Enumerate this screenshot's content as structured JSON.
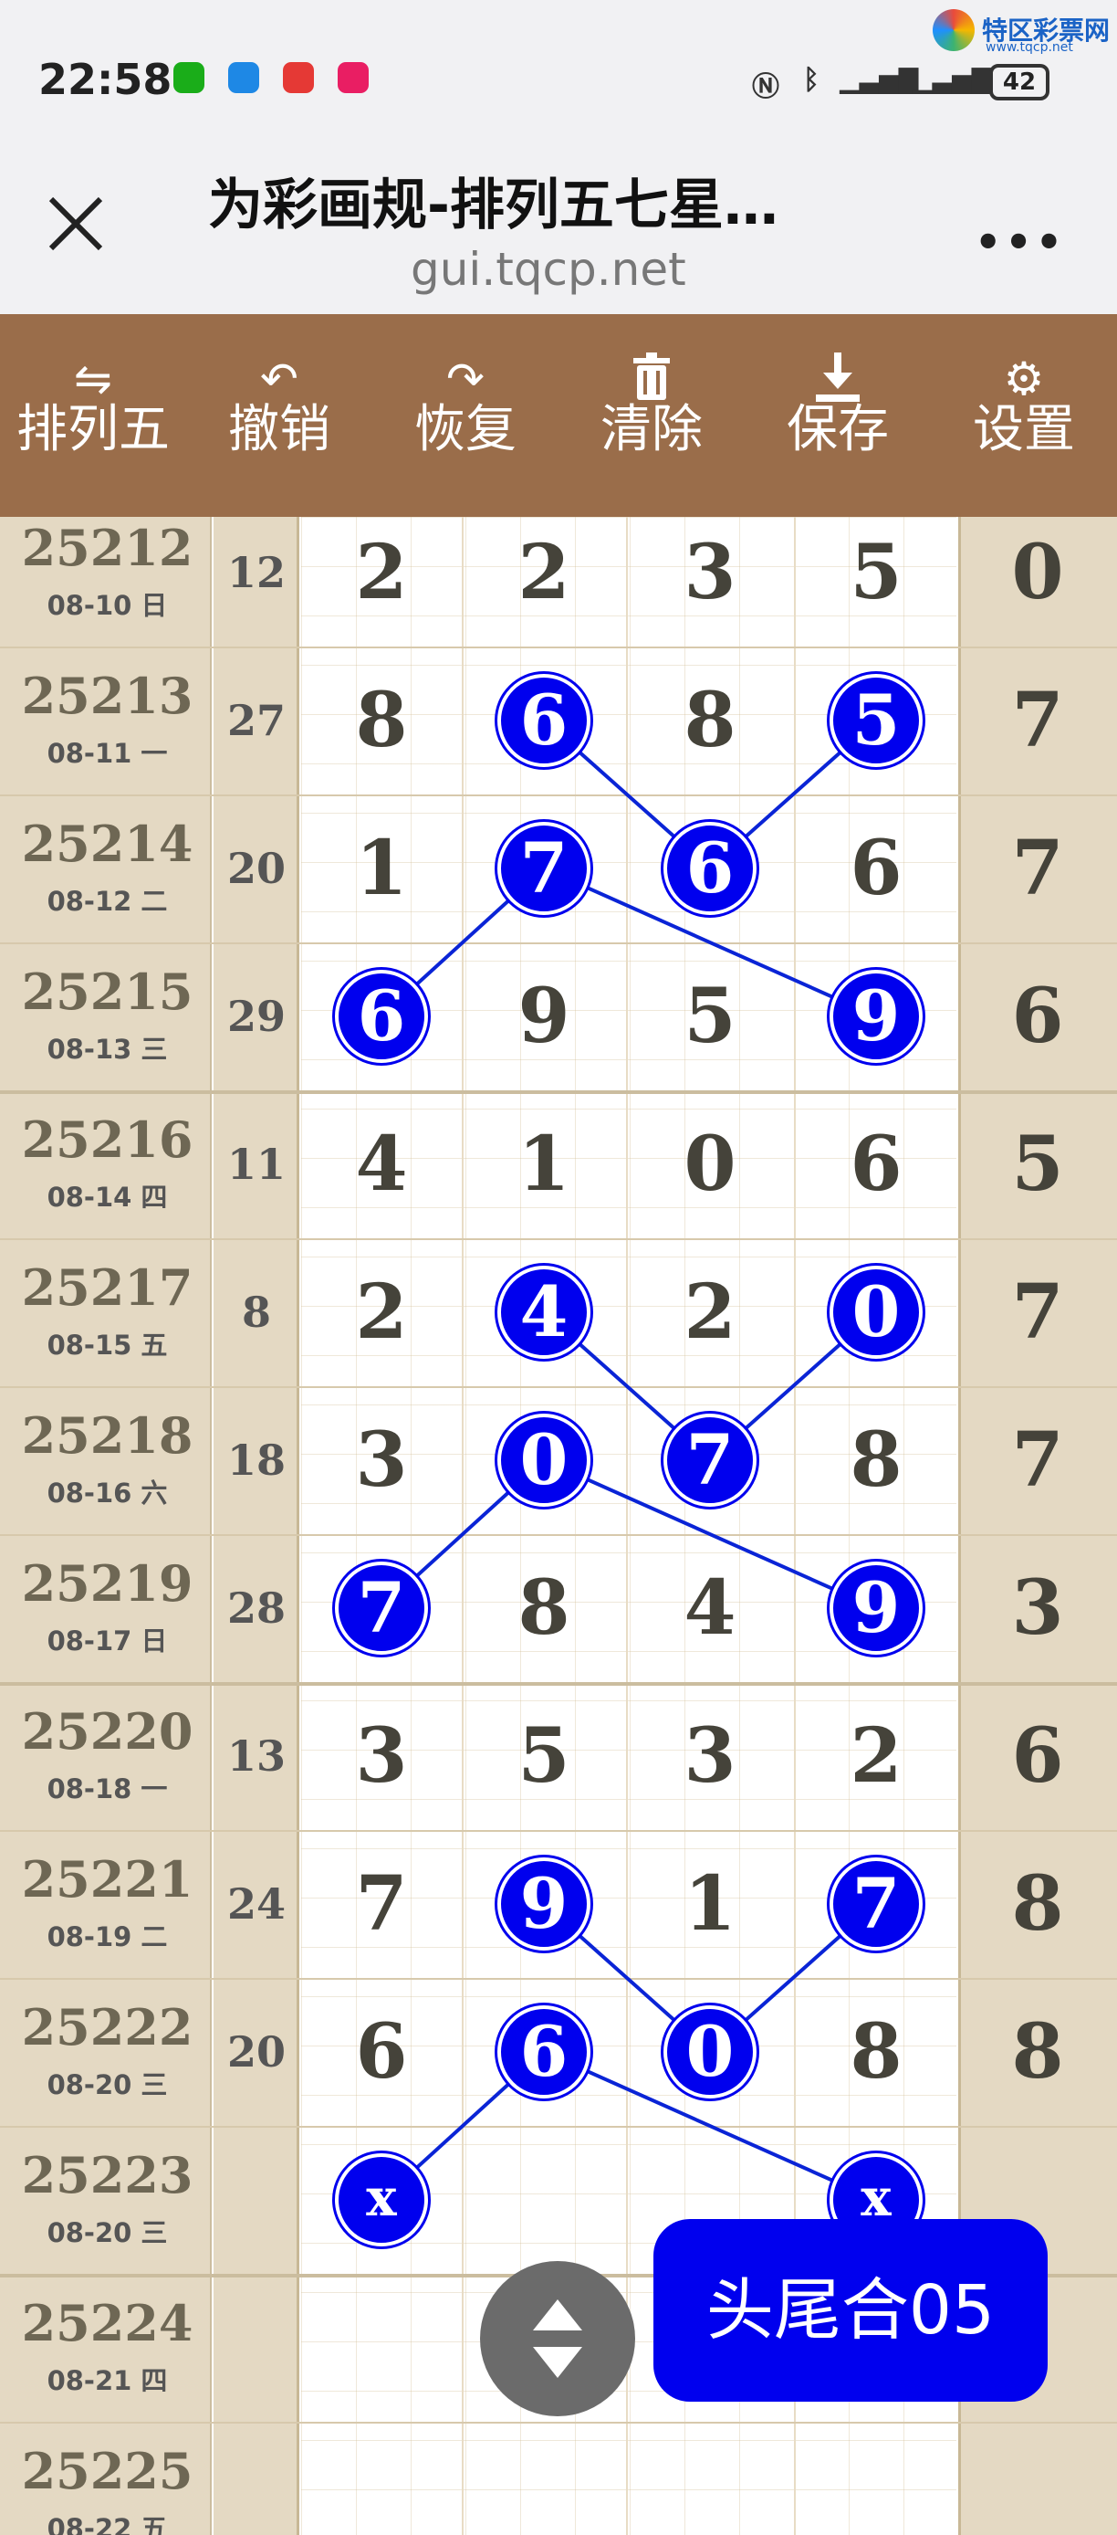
{
  "status_bar": {
    "time": "22:58",
    "battery": "42"
  },
  "watermark": {
    "name": "特区彩票网",
    "url": "www.tqcp.net"
  },
  "header": {
    "title": "为彩画规-排列五七星…",
    "url": "gui.tqcp.net"
  },
  "toolbar": [
    {
      "label": "排列五",
      "icon": "swap-arrows-icon"
    },
    {
      "label": "撤销",
      "icon": "undo-icon"
    },
    {
      "label": "恢复",
      "icon": "redo-icon"
    },
    {
      "label": "清除",
      "icon": "trash-icon"
    },
    {
      "label": "保存",
      "icon": "download-icon"
    },
    {
      "label": "设置",
      "icon": "gear-icon"
    }
  ],
  "rows": [
    {
      "period": "25212",
      "date": "08-10 日",
      "sum": "12",
      "digits": [
        "2",
        "2",
        "3",
        "5"
      ],
      "last": "0"
    },
    {
      "period": "25213",
      "date": "08-11 一",
      "sum": "27",
      "digits": [
        "8",
        "6",
        "8",
        "5"
      ],
      "last": "7"
    },
    {
      "period": "25214",
      "date": "08-12 二",
      "sum": "20",
      "digits": [
        "1",
        "7",
        "6",
        "6"
      ],
      "last": "7"
    },
    {
      "period": "25215",
      "date": "08-13 三",
      "sum": "29",
      "digits": [
        "6",
        "9",
        "5",
        "9"
      ],
      "last": "6"
    },
    {
      "period": "25216",
      "date": "08-14 四",
      "sum": "11",
      "digits": [
        "4",
        "1",
        "0",
        "6"
      ],
      "last": "5"
    },
    {
      "period": "25217",
      "date": "08-15 五",
      "sum": "8",
      "digits": [
        "2",
        "4",
        "2",
        "0"
      ],
      "last": "7"
    },
    {
      "period": "25218",
      "date": "08-16 六",
      "sum": "18",
      "digits": [
        "3",
        "0",
        "7",
        "8"
      ],
      "last": "7"
    },
    {
      "period": "25219",
      "date": "08-17 日",
      "sum": "28",
      "digits": [
        "7",
        "8",
        "4",
        "9"
      ],
      "last": "3"
    },
    {
      "period": "25220",
      "date": "08-18 一",
      "sum": "13",
      "digits": [
        "3",
        "5",
        "3",
        "2"
      ],
      "last": "6"
    },
    {
      "period": "25221",
      "date": "08-19 二",
      "sum": "24",
      "digits": [
        "7",
        "9",
        "1",
        "7"
      ],
      "last": "8"
    },
    {
      "period": "25222",
      "date": "08-20 三",
      "sum": "20",
      "digits": [
        "6",
        "6",
        "0",
        "8"
      ],
      "last": "8"
    },
    {
      "period": "25223",
      "date": "08-20 三",
      "sum": "",
      "digits": [
        "x",
        "",
        "",
        "x"
      ],
      "last": ""
    },
    {
      "period": "25224",
      "date": "08-21 四",
      "sum": "",
      "digits": [
        "",
        "",
        "",
        ""
      ],
      "last": ""
    },
    {
      "period": "25225",
      "date": "08-22 五",
      "sum": "",
      "digits": [
        "",
        "",
        "",
        ""
      ],
      "last": ""
    }
  ],
  "highlights": [
    {
      "row": 1,
      "col": 1
    },
    {
      "row": 1,
      "col": 3
    },
    {
      "row": 2,
      "col": 1
    },
    {
      "row": 2,
      "col": 2
    },
    {
      "row": 3,
      "col": 0
    },
    {
      "row": 3,
      "col": 3
    },
    {
      "row": 5,
      "col": 1
    },
    {
      "row": 5,
      "col": 3
    },
    {
      "row": 6,
      "col": 1
    },
    {
      "row": 6,
      "col": 2
    },
    {
      "row": 7,
      "col": 0
    },
    {
      "row": 7,
      "col": 3
    },
    {
      "row": 9,
      "col": 1
    },
    {
      "row": 9,
      "col": 3
    },
    {
      "row": 10,
      "col": 1
    },
    {
      "row": 10,
      "col": 2
    },
    {
      "row": 11,
      "col": 0
    },
    {
      "row": 11,
      "col": 3
    }
  ],
  "links": [
    [
      [
        1,
        1
      ],
      [
        2,
        2
      ]
    ],
    [
      [
        1,
        3
      ],
      [
        2,
        2
      ]
    ],
    [
      [
        2,
        1
      ],
      [
        3,
        0
      ]
    ],
    [
      [
        2,
        1
      ],
      [
        3,
        3
      ]
    ],
    [
      [
        5,
        1
      ],
      [
        6,
        2
      ]
    ],
    [
      [
        5,
        3
      ],
      [
        6,
        2
      ]
    ],
    [
      [
        6,
        1
      ],
      [
        7,
        0
      ]
    ],
    [
      [
        6,
        1
      ],
      [
        7,
        3
      ]
    ],
    [
      [
        9,
        1
      ],
      [
        10,
        2
      ]
    ],
    [
      [
        9,
        3
      ],
      [
        10,
        2
      ]
    ],
    [
      [
        10,
        1
      ],
      [
        11,
        0
      ]
    ],
    [
      [
        10,
        1
      ],
      [
        11,
        3
      ]
    ]
  ],
  "line_color": "#0a24d6",
  "ball_color": "#0000ee",
  "toolbar_color": "#9a6d4a",
  "floating_badge": {
    "label": "头尾合05"
  }
}
